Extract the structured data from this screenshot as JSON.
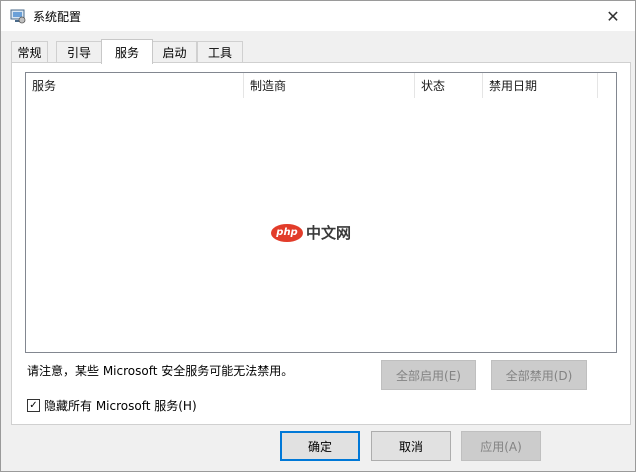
{
  "window": {
    "title": "系统配置",
    "close_glyph": "✕"
  },
  "tabs": [
    {
      "label": "常规"
    },
    {
      "label": "引导"
    },
    {
      "label": "服务",
      "active": true
    },
    {
      "label": "启动"
    },
    {
      "label": "工具"
    }
  ],
  "services_list": {
    "columns": [
      "服务",
      "制造商",
      "状态",
      "禁用日期"
    ],
    "rows": []
  },
  "watermark": {
    "logo_text": "php",
    "text": "中文网"
  },
  "note": "请注意，某些 Microsoft 安全服务可能无法禁用。",
  "buttons": {
    "enable_all": "全部启用(E)",
    "disable_all": "全部禁用(D)",
    "ok": "确定",
    "cancel": "取消",
    "apply": "应用(A)"
  },
  "hide_ms_services": {
    "label": "隐藏所有 Microsoft 服务(H)",
    "checked": true,
    "check_glyph": "✓"
  },
  "colors": {
    "accent": "#0078d7",
    "watermark_red": "#e23c2a"
  }
}
